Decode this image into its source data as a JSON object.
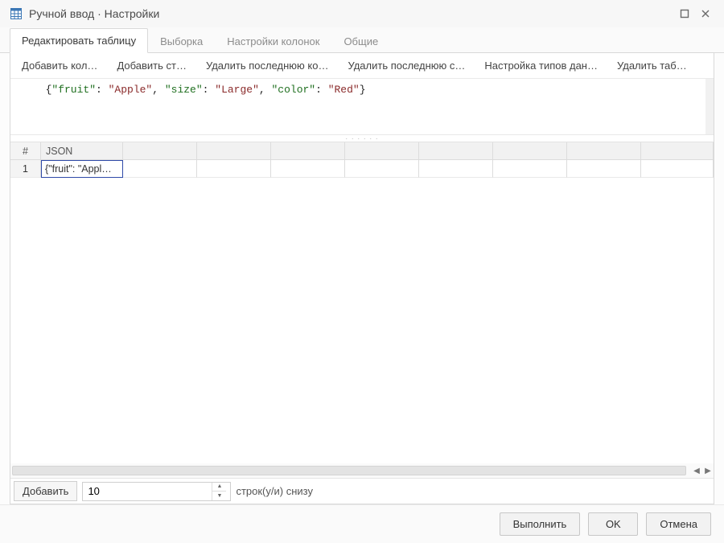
{
  "window": {
    "title": "Ручной ввод · Настройки"
  },
  "tabs": [
    {
      "label": "Редактировать таблицу",
      "active": true
    },
    {
      "label": "Выборка",
      "active": false
    },
    {
      "label": "Настройки колонок",
      "active": false
    },
    {
      "label": "Общие",
      "active": false
    }
  ],
  "toolbar": {
    "add_col": "Добавить кол…",
    "add_row": "Добавить ст…",
    "del_last_col": "Удалить последнюю ко…",
    "del_last_row": "Удалить последнюю с…",
    "type_config": "Настройка типов дан…",
    "del_table": "Удалить таб…"
  },
  "editor": {
    "line1_raw": "  {\"fruit\": \"Apple\", \"size\": \"Large\", \"color\": \"Red\"}"
  },
  "grid": {
    "columns": {
      "rownum": "#",
      "json": "JSON"
    },
    "rows": [
      {
        "num": "1",
        "json": "{\"fruit\": \"Appl…"
      }
    ]
  },
  "addbar": {
    "button": "Добавить",
    "count": "10",
    "suffix": "строк(у/и) снизу"
  },
  "footer": {
    "execute": "Выполнить",
    "ok": "OK",
    "cancel": "Отмена"
  }
}
